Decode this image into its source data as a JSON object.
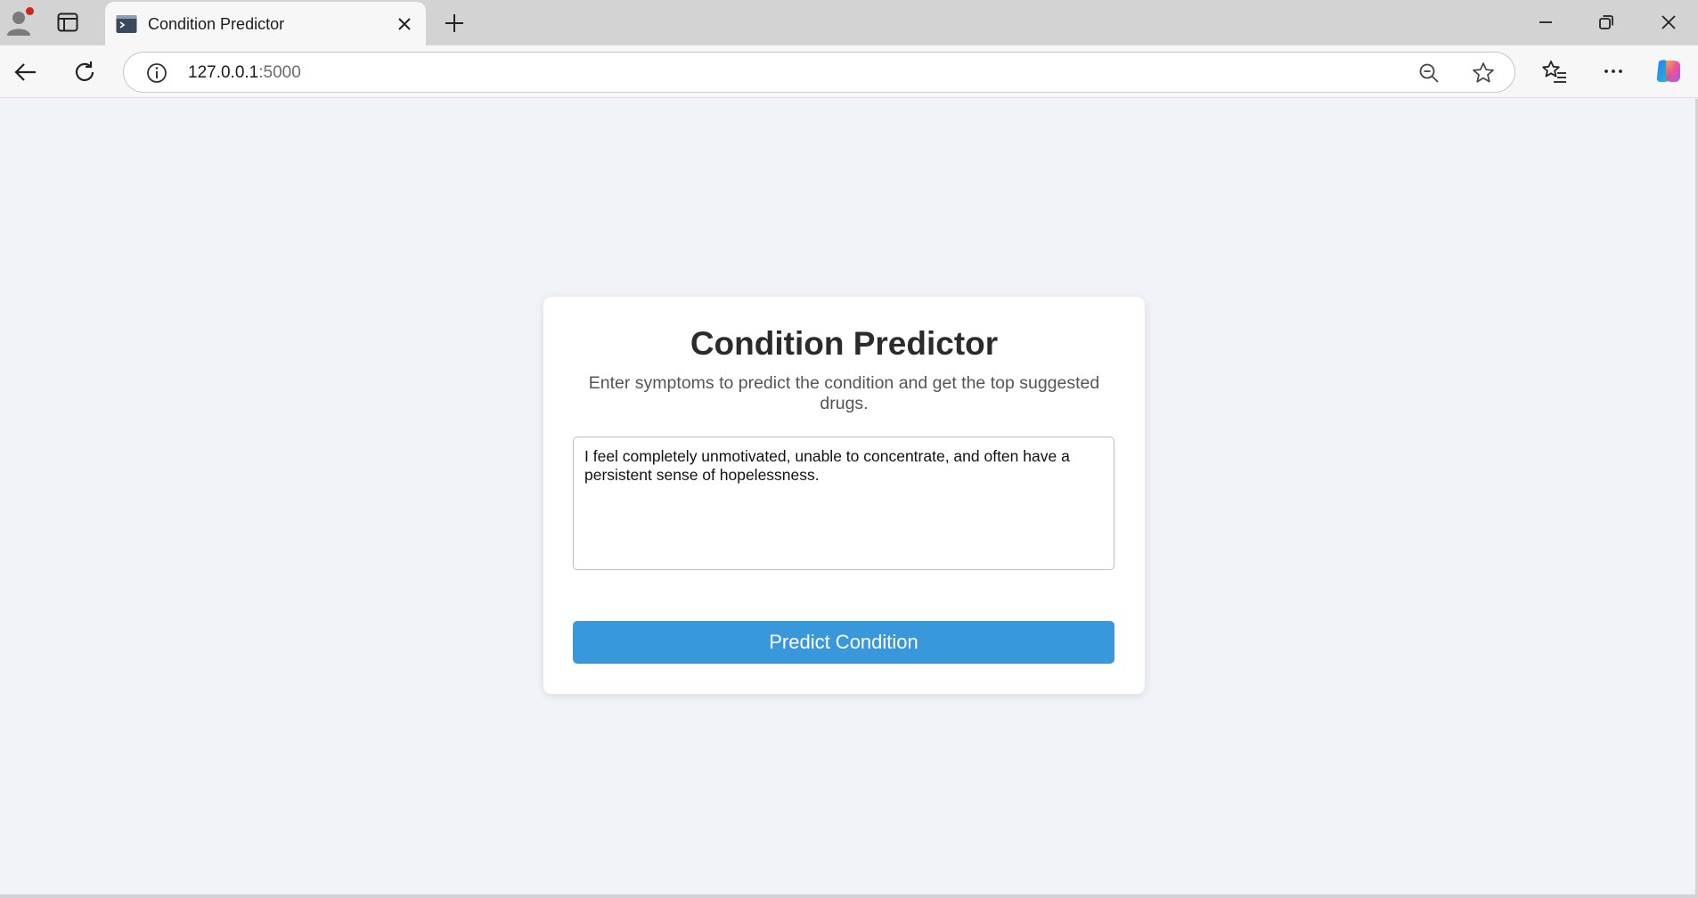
{
  "browser": {
    "tab": {
      "title": "Condition Predictor"
    },
    "address": {
      "host": "127.0.0.1",
      "port": ":5000"
    }
  },
  "page": {
    "title": "Condition Predictor",
    "subtitle": "Enter symptoms to predict the condition and get the top suggested drugs.",
    "symptoms_value": "I feel completely unmotivated, unable to concentrate, and often have a persistent sense of hopelessness.",
    "predict_button_label": "Predict Condition"
  },
  "colors": {
    "page_background": "#f0f3f7",
    "button": "#3998dc",
    "card": "#ffffff"
  },
  "icons": [
    "profile-icon",
    "workspaces-icon",
    "terminal-favicon-icon",
    "close-icon",
    "plus-icon",
    "minimize-icon",
    "restore-icon",
    "close-window-icon",
    "back-arrow-icon",
    "reload-icon",
    "info-icon",
    "zoom-out-icon",
    "star-icon",
    "favorites-icon",
    "more-icon",
    "copilot-icon"
  ]
}
